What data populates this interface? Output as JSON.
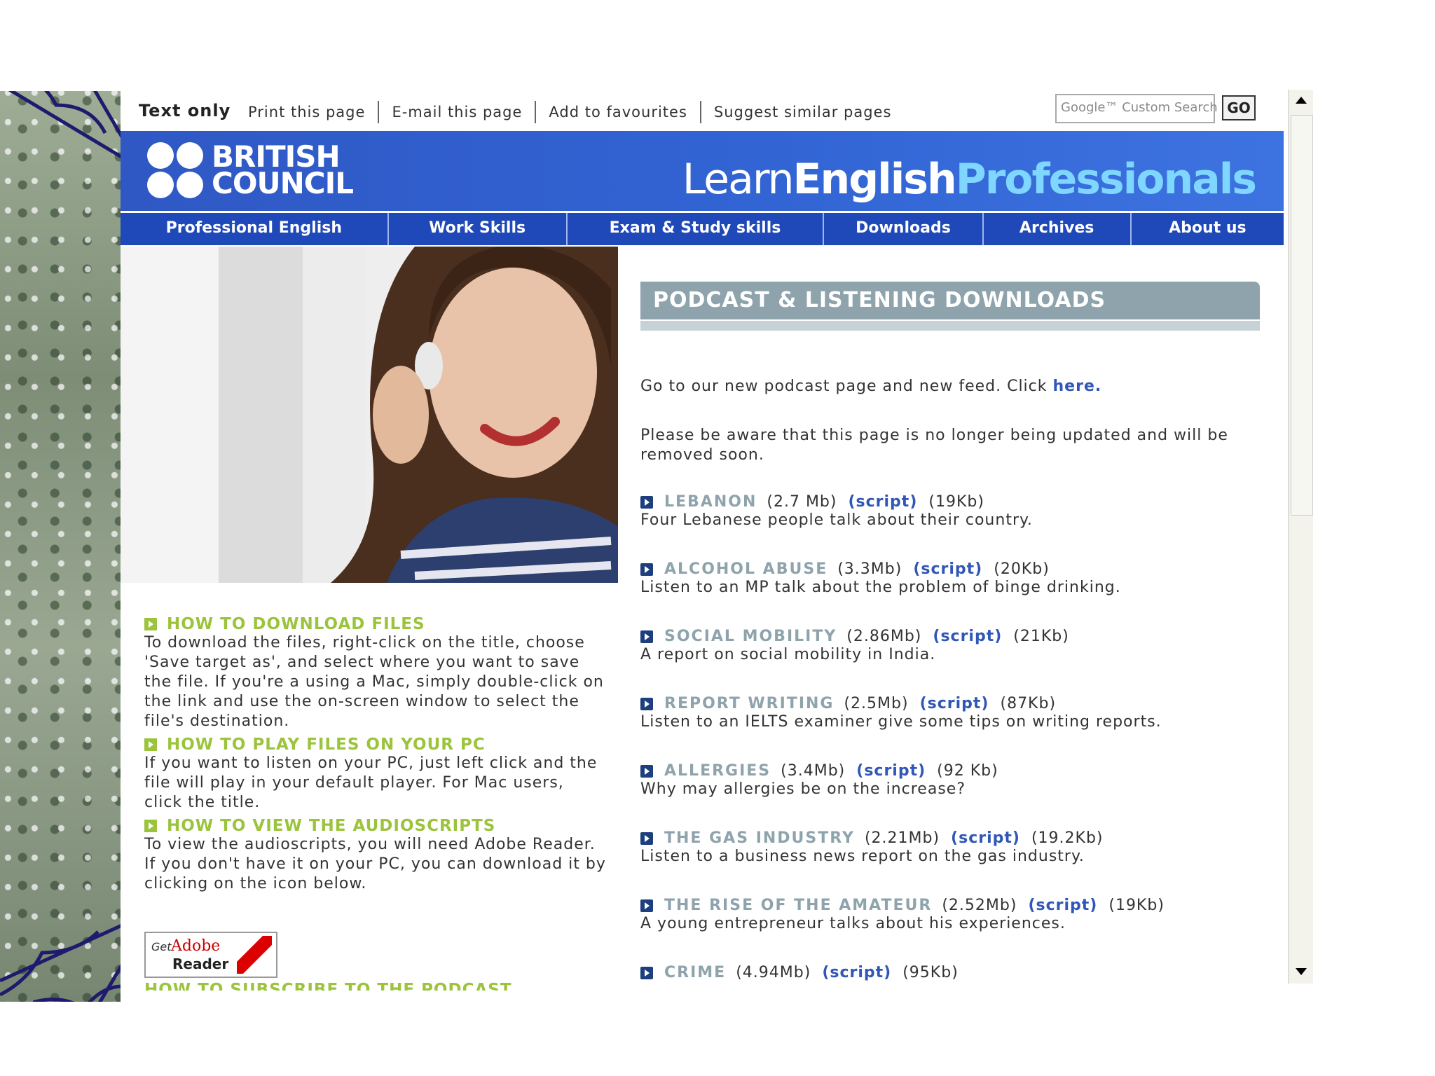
{
  "utility": {
    "text_only": "Text only",
    "links": [
      "Print this page",
      "E-mail this page",
      "Add to favourites",
      "Suggest similar pages"
    ],
    "search_placeholder": "Google™ Custom Search",
    "go": "GO"
  },
  "header": {
    "logo_line1": "BRITISH",
    "logo_line2": "COUNCIL",
    "site_part1": "Learn",
    "site_part2": "English",
    "site_part3": "Professionals"
  },
  "nav": [
    "Professional English",
    "Work Skills",
    "Exam & Study skills",
    "Downloads",
    "Archives",
    "About us"
  ],
  "help": [
    {
      "title": "HOW TO DOWNLOAD FILES",
      "body": "To download the files, right-click on the title, choose 'Save target as', and select where you want to save the file. If you're a using a Mac, simply double-click on the link and use the on-screen window to select the file's destination."
    },
    {
      "title": "HOW TO PLAY FILES ON YOUR PC",
      "body": "If you want to listen on your PC, just left click and the file will play in your default player. For Mac users, click the title."
    },
    {
      "title": "HOW TO VIEW THE AUDIOSCRIPTS",
      "body": "To view the audioscripts, you will need Adobe Reader. If you don't have it on your PC, you can download it by clicking on the icon below."
    }
  ],
  "adobe": {
    "get": "Get",
    "name": "Adobe",
    "reader": "Reader"
  },
  "cut_heading": "HOW TO SUBSCRIBE TO THE PODCAST",
  "section": {
    "title": "PODCAST & LISTENING DOWNLOADS",
    "intro": "Go to our new podcast page and new feed. Click ",
    "intro_link": "here.",
    "notice": "Please be aware that this page is no longer being updated and will be removed soon."
  },
  "downloads": [
    {
      "title": "LEBANON",
      "size": "(2.7 Mb)",
      "script": "(script)",
      "script_size": "(19Kb)",
      "desc": "Four Lebanese people talk about their country."
    },
    {
      "title": "ALCOHOL ABUSE",
      "size": "(3.3Mb)",
      "script": "(script)",
      "script_size": "(20Kb)",
      "desc": "Listen to an MP talk about the problem of binge drinking."
    },
    {
      "title": "SOCIAL MOBILITY",
      "size": "(2.86Mb)",
      "script": "(script)",
      "script_size": "(21Kb)",
      "desc": "A report on social mobility in India."
    },
    {
      "title": "REPORT WRITING",
      "size": "(2.5Mb)",
      "script": "(script)",
      "script_size": "(87Kb)",
      "desc": "Listen to an IELTS examiner give some tips on writing reports."
    },
    {
      "title": "ALLERGIES",
      "size": "(3.4Mb)",
      "script": "(script)",
      "script_size": "(92 Kb)",
      "desc": "Why may allergies be on the increase?"
    },
    {
      "title": "THE GAS INDUSTRY",
      "size": "(2.21Mb)",
      "script": "(script)",
      "script_size": "(19.2Kb)",
      "desc": "Listen to a business news report on the gas industry."
    },
    {
      "title": "THE RISE OF THE AMATEUR",
      "size": "(2.52Mb)",
      "script": "(script)",
      "script_size": "(19Kb)",
      "desc": "A young entrepreneur talks about his experiences."
    },
    {
      "title": "CRIME",
      "size": "(4.94Mb)",
      "script": "(script)",
      "script_size": "(95Kb)",
      "desc": ""
    }
  ]
}
